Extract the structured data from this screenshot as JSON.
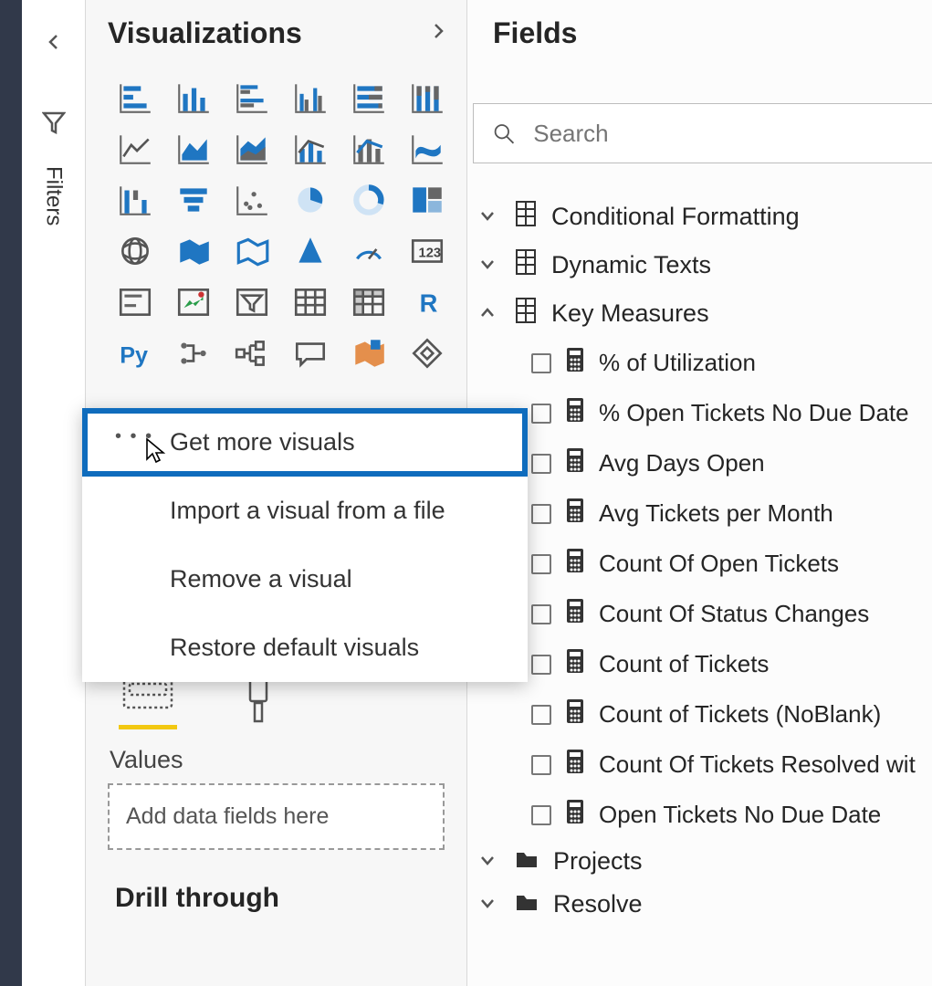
{
  "filters_rail": {
    "label": "Filters"
  },
  "viz": {
    "title": "Visualizations",
    "values_label": "Values",
    "drop_placeholder": "Add data fields here",
    "drill_label": "Drill through"
  },
  "context_menu": {
    "get_more": "Get more visuals",
    "import_file": "Import a visual from a file",
    "remove": "Remove a visual",
    "restore": "Restore default visuals"
  },
  "fields": {
    "title": "Fields",
    "search_placeholder": "Search",
    "tables": [
      {
        "name": "Conditional Formatting",
        "expanded": false,
        "icon": "table"
      },
      {
        "name": "Dynamic Texts",
        "expanded": false,
        "icon": "table"
      },
      {
        "name": "Key Measures",
        "expanded": true,
        "icon": "table",
        "measures": [
          "% of Utilization",
          "% Open Tickets No Due Date",
          "Avg Days Open",
          "Avg Tickets per Month",
          "Count Of Open Tickets",
          "Count Of Status Changes",
          "Count of Tickets",
          "Count of Tickets (NoBlank)",
          "Count Of Tickets Resolved wit",
          "Open Tickets No Due Date"
        ]
      },
      {
        "name": "Projects",
        "expanded": false,
        "icon": "folder"
      },
      {
        "name": "Resolve",
        "expanded": false,
        "icon": "folder"
      }
    ]
  }
}
